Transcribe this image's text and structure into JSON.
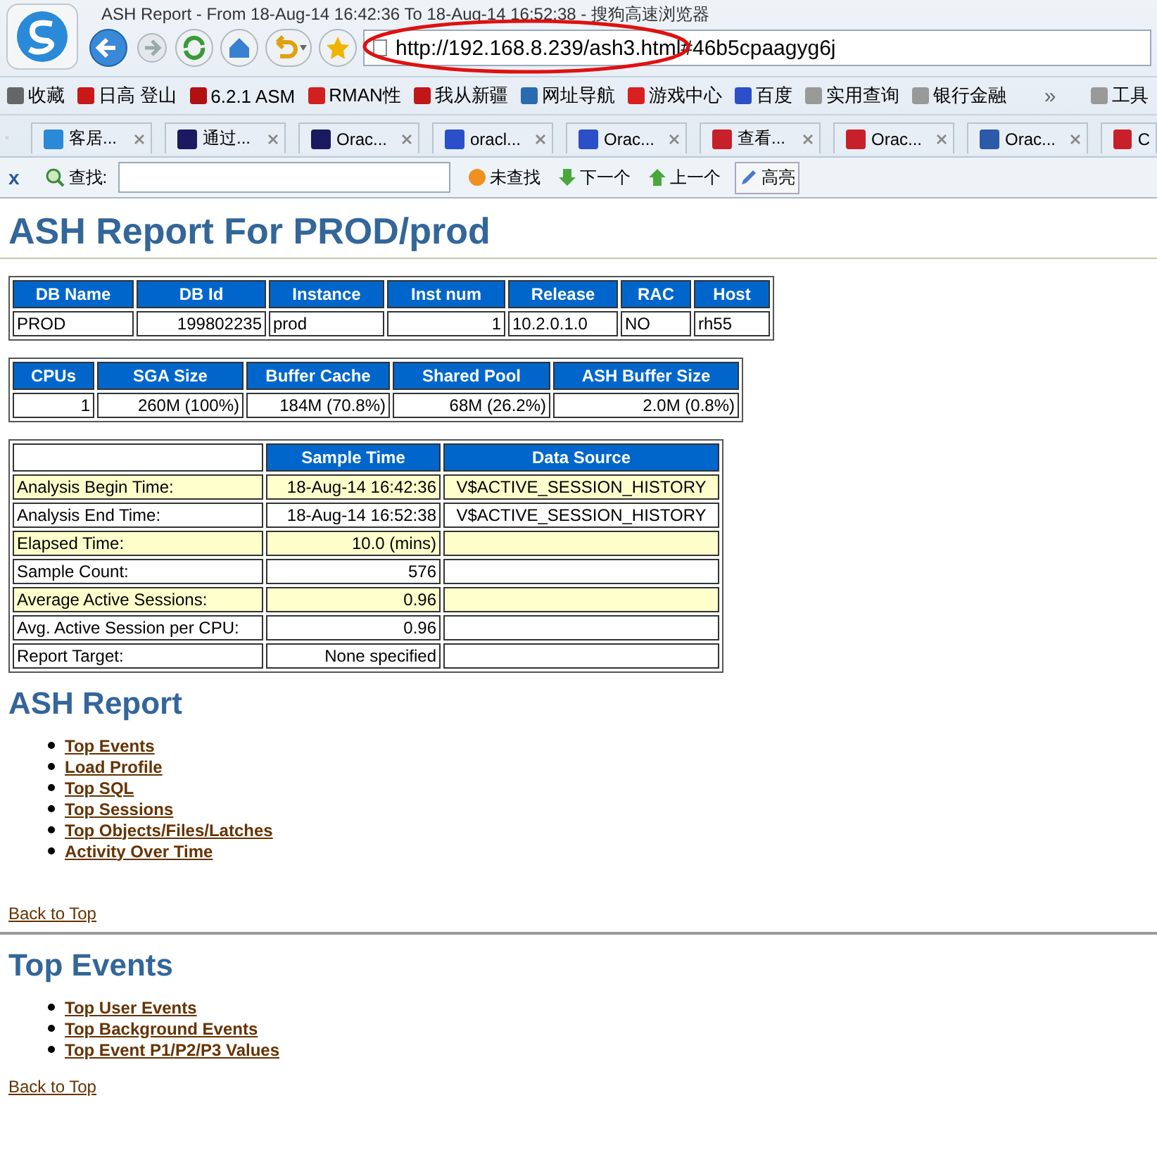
{
  "window": {
    "title": "ASH Report - From 18-Aug-14 16:42:36 To 18-Aug-14 16:52:38 - 搜狗高速浏览器"
  },
  "address_bar": {
    "value": "http://192.168.8.239/ash3.html#46b5cpaagyg6j",
    "annotated": true
  },
  "bookmarks": [
    {
      "kind": "plus",
      "label": "收藏"
    },
    {
      "kind": "t-logo",
      "label": "日高 登山"
    },
    {
      "kind": "shield",
      "label": "6.2.1 ASM"
    },
    {
      "kind": "rman",
      "label": "RMAN性"
    },
    {
      "kind": "bookmark",
      "label": "我从新疆"
    },
    {
      "kind": "globe",
      "label": "网址导航"
    },
    {
      "kind": "game",
      "label": "游戏中心"
    },
    {
      "kind": "paw",
      "label": "百度"
    },
    {
      "kind": "folder",
      "label": "实用查询"
    },
    {
      "kind": "folder",
      "label": "银行金融"
    }
  ],
  "more_symbol": "»",
  "tools_label": "工具",
  "tabs": [
    {
      "kind": "three",
      "label": "客居..."
    },
    {
      "kind": "v",
      "label": "通过..."
    },
    {
      "kind": "v",
      "label": "Orac..."
    },
    {
      "kind": "paw",
      "label": "oracl..."
    },
    {
      "kind": "paw",
      "label": "Orac..."
    },
    {
      "kind": "c-red",
      "label": "查看..."
    },
    {
      "kind": "c-red",
      "label": "Orac..."
    },
    {
      "kind": "c-blue",
      "label": "Orac..."
    },
    {
      "kind": "c-red",
      "label": "C"
    }
  ],
  "find_bar": {
    "close": "x",
    "label": "查找:",
    "buttons": [
      {
        "kind": "pie",
        "label": "未查找"
      },
      {
        "kind": "down",
        "label": "下一个"
      },
      {
        "kind": "up",
        "label": "上一个"
      },
      {
        "kind": "pen",
        "label": "高亮"
      }
    ]
  },
  "page": {
    "title": "ASH Report For PROD/prod",
    "db_table": {
      "columns": [
        "DB Name",
        "DB Id",
        "Instance",
        "Inst num",
        "Release",
        "RAC",
        "Host"
      ],
      "rows": [
        [
          "PROD",
          "199802235",
          "prod",
          "1",
          "10.2.0.1.0",
          "NO",
          "rh55"
        ]
      ]
    },
    "sga_table": {
      "columns": [
        "CPUs",
        "SGA Size",
        "Buffer Cache",
        "Shared Pool",
        "ASH Buffer Size"
      ],
      "rows": [
        [
          "1",
          "260M (100%)",
          "184M (70.8%)",
          "68M (26.2%)",
          "2.0M (0.8%)"
        ]
      ]
    },
    "sample_table": {
      "columns": [
        "Sample Time",
        "Data Source"
      ],
      "rows": [
        {
          "label": "Analysis Begin Time:",
          "sample_time": "18-Aug-14 16:42:36",
          "data_source": "V$ACTIVE_SESSION_HISTORY",
          "highlighted": true
        },
        {
          "label": "Analysis End Time:",
          "sample_time": "18-Aug-14 16:52:38",
          "data_source": "V$ACTIVE_SESSION_HISTORY",
          "highlighted": false
        },
        {
          "label": "Elapsed Time:",
          "sample_time": "10.0 (mins)",
          "highlighted": true
        },
        {
          "label": "Sample Count:",
          "sample_time": "576",
          "highlighted": false
        },
        {
          "label": "Average Active Sessions:",
          "sample_time": "0.96",
          "highlighted": true
        },
        {
          "label": "Avg. Active Session per CPU:",
          "sample_time": "0.96",
          "highlighted": false
        },
        {
          "label": "Report Target:",
          "sample_time": "None specified",
          "highlighted": false
        }
      ]
    },
    "sections": [
      {
        "title": "ASH Report",
        "links": [
          "Top Events",
          "Load Profile",
          "Top SQL",
          "Top Sessions",
          "Top Objects/Files/Latches",
          "Activity Over Time"
        ],
        "back_link": "Back to Top"
      },
      {
        "title": "Top Events",
        "links": [
          "Top User Events",
          "Top Background Events",
          "Top Event P1/P2/P3 Values"
        ],
        "back_link": "Back to Top"
      }
    ]
  }
}
